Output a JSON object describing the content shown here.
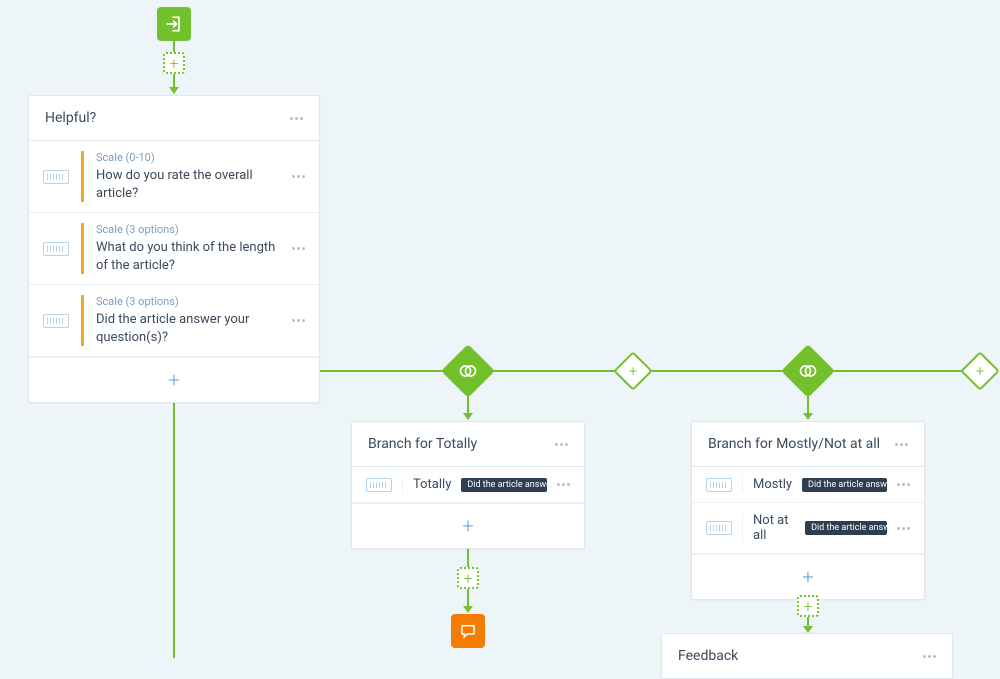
{
  "start": {
    "icon": "entry-icon"
  },
  "cards": {
    "helpful": {
      "title": "Helpful?",
      "questions": [
        {
          "type_label": "Scale (0-10)",
          "text": "How do you rate the overall article?"
        },
        {
          "type_label": "Scale (3 options)",
          "text": "What do you think of the length of the article?"
        },
        {
          "type_label": "Scale (3 options)",
          "text": "Did the article answer your question(s)?"
        }
      ]
    },
    "branch_totally": {
      "title": "Branch for Totally",
      "rows": [
        {
          "answer": "Totally",
          "badge": "Did the article answer yo"
        }
      ]
    },
    "branch_mostly": {
      "title": "Branch for Mostly/Not at all",
      "rows": [
        {
          "answer": "Mostly",
          "badge": "Did the article answer yo"
        },
        {
          "answer": "Not at all",
          "badge": "Did the article answer"
        }
      ]
    },
    "feedback": {
      "title": "Feedback"
    }
  },
  "glyphs": {
    "plus": "+"
  }
}
